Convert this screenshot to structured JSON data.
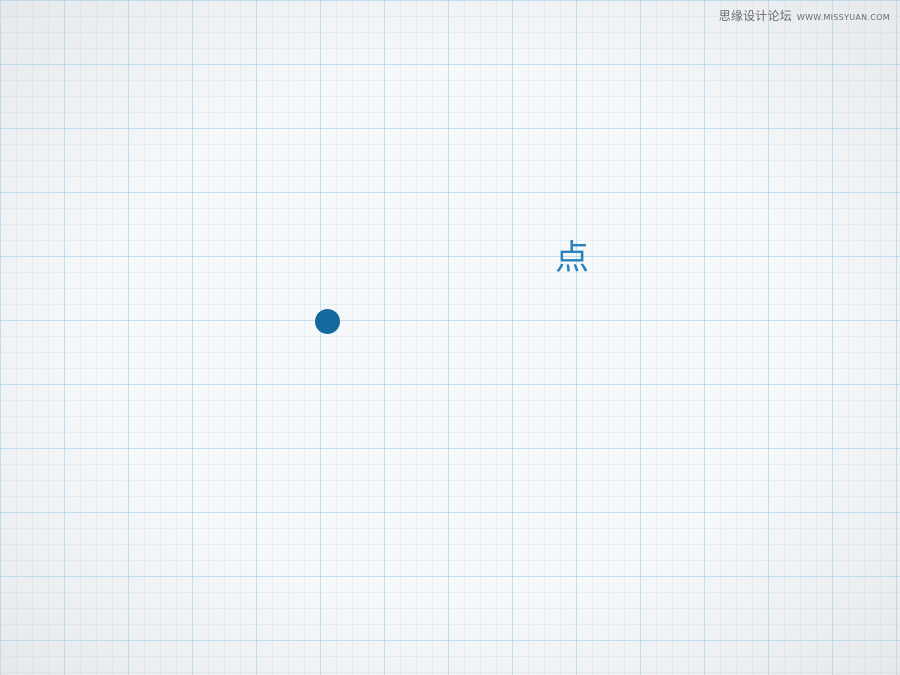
{
  "watermark": {
    "text": "思缘设计论坛",
    "site": "WWW.MISSYUAN.COM"
  },
  "slide": {
    "heading": "点",
    "dot": {
      "shape": "circle",
      "color": "#14699c"
    }
  },
  "colors": {
    "background": "#f6f8fa",
    "grid": "#a9d3ea",
    "heading": "#2a82bd"
  }
}
